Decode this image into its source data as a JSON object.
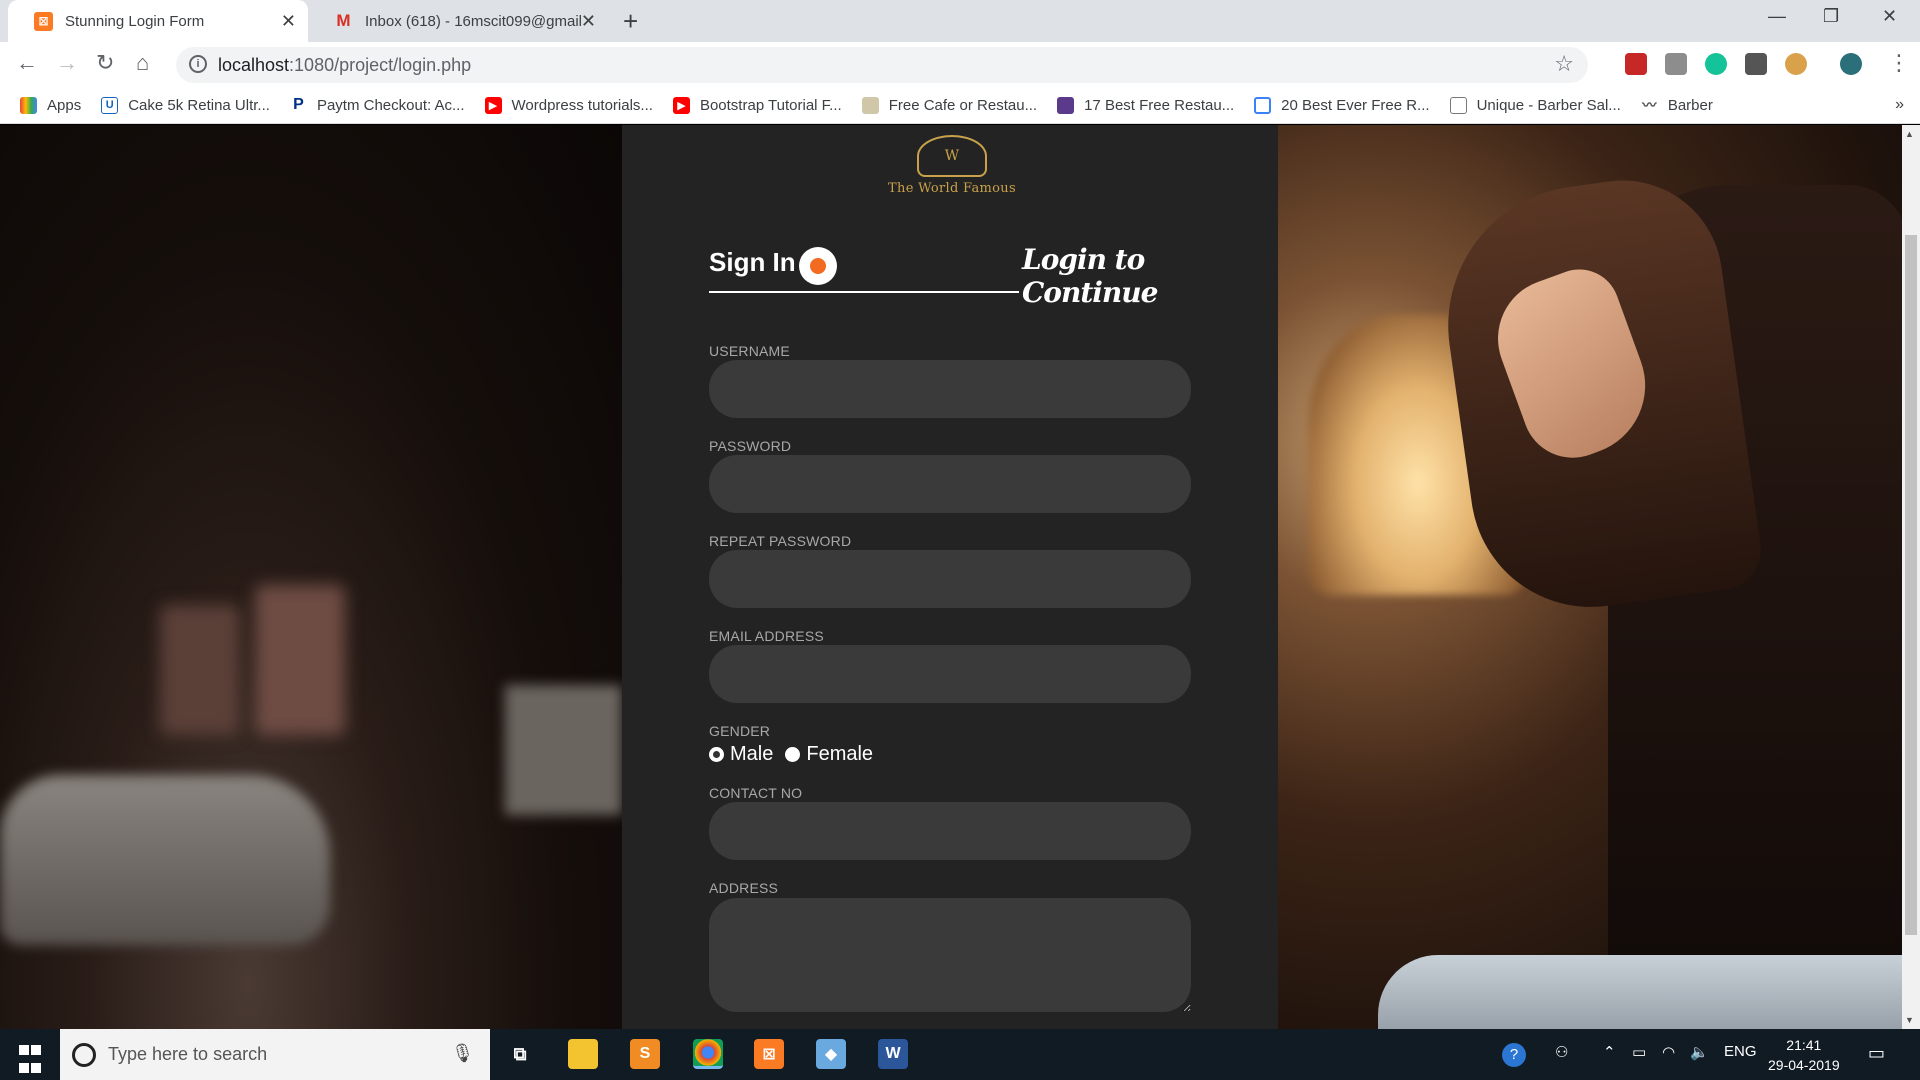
{
  "browser": {
    "tabs": [
      {
        "title": "Stunning Login Form",
        "active": true,
        "icon": "xampp-icon"
      },
      {
        "title": "Inbox (618) - 16mscit099@gmail",
        "active": false,
        "icon": "gmail-icon"
      }
    ],
    "url_host": "localhost",
    "url_path": ":1080/project/login.php",
    "bookmarks": [
      {
        "label": "Apps",
        "icon": "apps-grid-icon"
      },
      {
        "label": "Cake 5k Retina Ultr...",
        "icon": "u-logo-icon"
      },
      {
        "label": "Paytm Checkout: Ac...",
        "icon": "paypal-icon"
      },
      {
        "label": "Wordpress tutorials...",
        "icon": "youtube-icon"
      },
      {
        "label": "Bootstrap Tutorial F...",
        "icon": "youtube-icon"
      },
      {
        "label": "Free Cafe or Restau...",
        "icon": "thumbnail-icon"
      },
      {
        "label": "17 Best Free Restau...",
        "icon": "colorlib-icon"
      },
      {
        "label": "20 Best Ever Free R...",
        "icon": "blue-square-icon"
      },
      {
        "label": "Unique - Barber Sal...",
        "icon": "page-icon"
      },
      {
        "label": "Barber",
        "icon": "mustache-icon"
      }
    ]
  },
  "logo": {
    "name": "The World Famous",
    "crest_letters": "W"
  },
  "form": {
    "signin_tab": "Sign In",
    "login_continue": "Login to Continue",
    "fields": {
      "username": {
        "label": "USERNAME",
        "value": ""
      },
      "password": {
        "label": "PASSWORD",
        "value": ""
      },
      "repeat_password": {
        "label": "REPEAT PASSWORD",
        "value": ""
      },
      "email": {
        "label": "EMAIL ADDRESS",
        "value": ""
      },
      "gender": {
        "label": "GENDER",
        "options": [
          "Male",
          "Female"
        ],
        "selected": "Male"
      },
      "contact": {
        "label": "CONTACT NO",
        "value": ""
      },
      "address": {
        "label": "ADDRESS",
        "value": ""
      }
    }
  },
  "taskbar": {
    "search_placeholder": "Type here to search",
    "lang": "ENG",
    "time": "21:41",
    "date": "29-04-2019"
  },
  "colors": {
    "accent": "#f26b21",
    "panel": "#232323",
    "input": "#3a3a3a",
    "gold": "#c9a14a"
  }
}
